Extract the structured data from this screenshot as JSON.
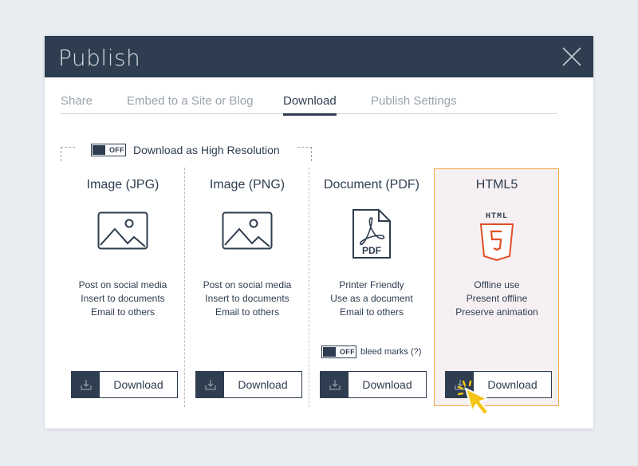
{
  "dialog": {
    "title": "Publish"
  },
  "tabs": [
    {
      "label": "Share",
      "active": false
    },
    {
      "label": "Embed to a Site or Blog",
      "active": false
    },
    {
      "label": "Download",
      "active": true
    },
    {
      "label": "Publish Settings",
      "active": false
    }
  ],
  "high_resolution": {
    "toggle_state": "OFF",
    "label": "Download as High Resolution"
  },
  "columns": [
    {
      "title": "Image (JPG)",
      "icon": "image-icon",
      "lines": [
        "Post on social media",
        "Insert to documents",
        "Email to others"
      ],
      "button": "Download"
    },
    {
      "title": "Image (PNG)",
      "icon": "image-icon",
      "lines": [
        "Post on social media",
        "Insert to documents",
        "Email to others"
      ],
      "button": "Download"
    },
    {
      "title": "Document (PDF)",
      "icon": "pdf-document-icon",
      "icon_text": "PDF",
      "lines": [
        "Printer Friendly",
        "Use as a document",
        "Email to others"
      ],
      "bleed_toggle_state": "OFF",
      "bleed_label": "bleed marks (?)",
      "button": "Download"
    },
    {
      "title": "HTML5",
      "icon": "html5-icon",
      "icon_text": "HTML",
      "lines": [
        "Offline use",
        "Present offline",
        "Preserve animation"
      ],
      "button": "Download",
      "highlighted": true
    }
  ],
  "colors": {
    "header_bg": "#2e3d4f",
    "highlight_border": "#f0a94a",
    "highlight_bg": "#f6f0f3",
    "html5_red": "#e34f26",
    "cursor_yellow": "#f5c518"
  }
}
